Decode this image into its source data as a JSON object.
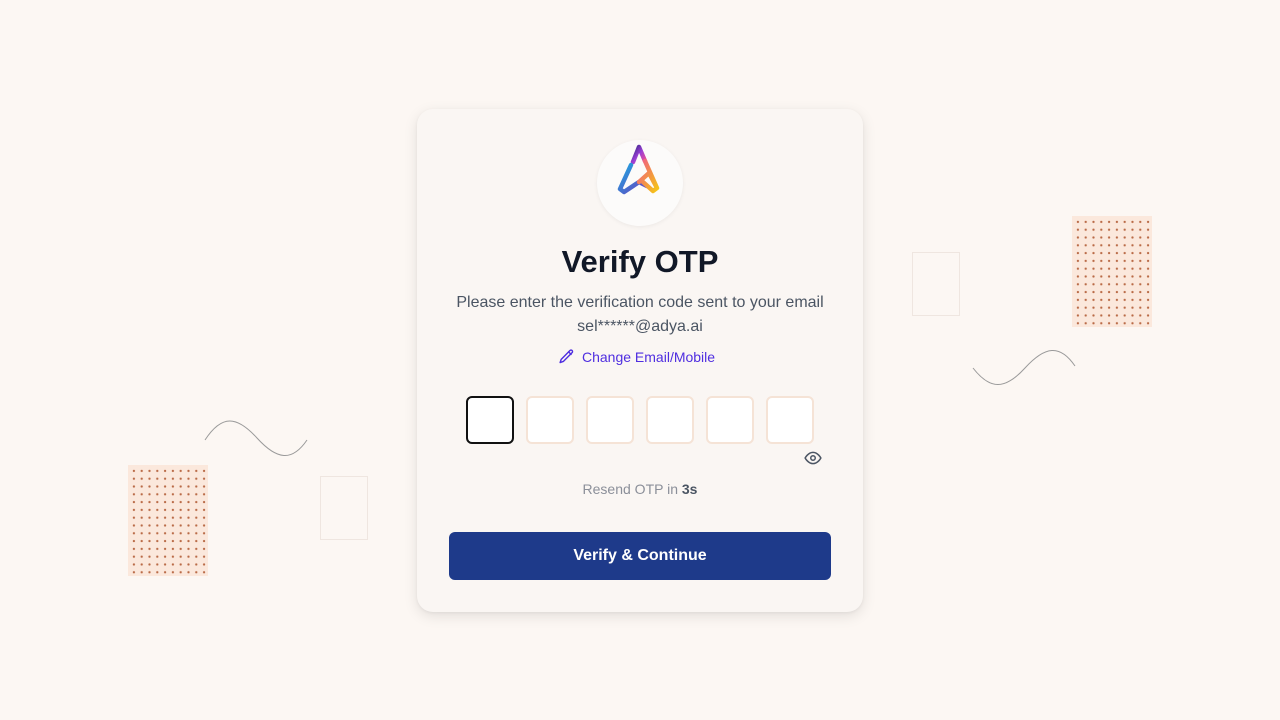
{
  "verify": {
    "title": "Verify OTP",
    "subtitle": "Please enter the verification code sent to your email",
    "email": "sel******@adya.ai",
    "change_link": "Change Email/Mobile",
    "otp_digits": [
      "",
      "",
      "",
      "",
      "",
      ""
    ],
    "resend_prefix": "Resend OTP in",
    "resend_countdown": "3s",
    "button_label": "Verify & Continue"
  },
  "icons": {
    "logo": "adya-logo",
    "change": "pencil-icon",
    "visibility": "eye-icon"
  },
  "colors": {
    "background": "#fcf7f3",
    "card": "#faf6f3",
    "primary_button": "#1e3a8a",
    "link": "#4f2ee0",
    "active_input_border": "#111111"
  }
}
